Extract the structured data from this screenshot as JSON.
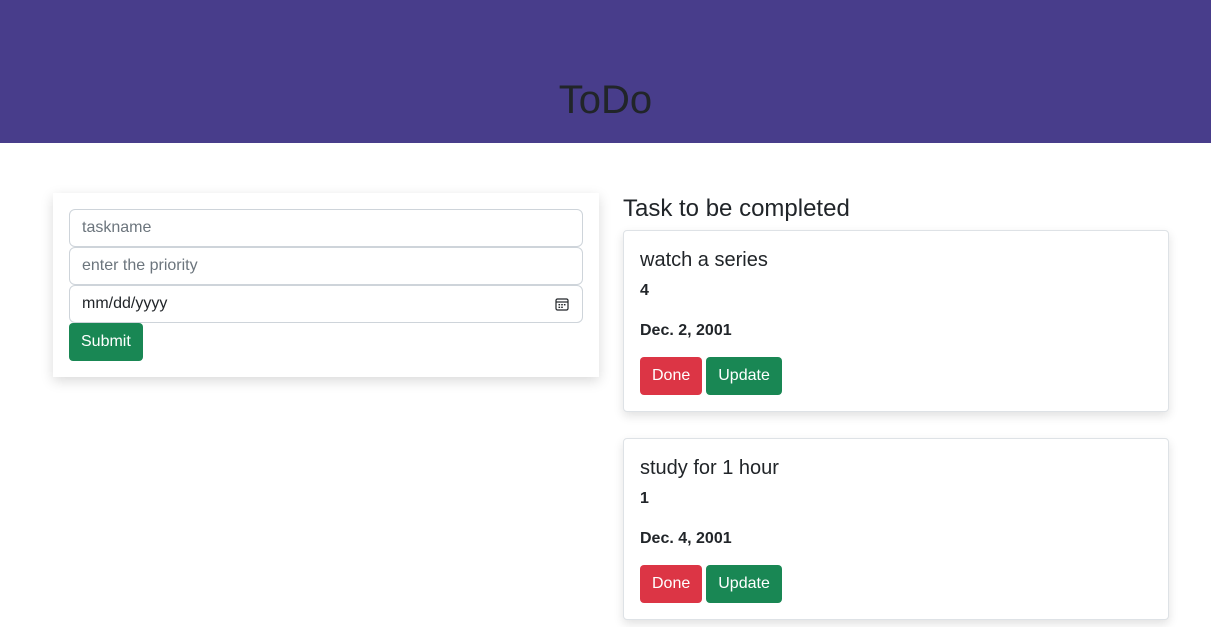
{
  "header": {
    "title": "ToDo"
  },
  "form": {
    "taskname_placeholder": "taskname",
    "priority_placeholder": "enter the priority",
    "date_placeholder": "mm/dd/yyyy",
    "submit_label": "Submit"
  },
  "tasks_section": {
    "title": "Task to be completed"
  },
  "tasks": [
    {
      "name": "watch a series",
      "priority": "4",
      "date": "Dec. 2, 2001",
      "done_label": "Done",
      "update_label": "Update"
    },
    {
      "name": "study for 1 hour",
      "priority": "1",
      "date": "Dec. 4, 2001",
      "done_label": "Done",
      "update_label": "Update"
    }
  ],
  "colors": {
    "header_bg": "#483d8b",
    "success": "#198754",
    "danger": "#dc3545"
  }
}
